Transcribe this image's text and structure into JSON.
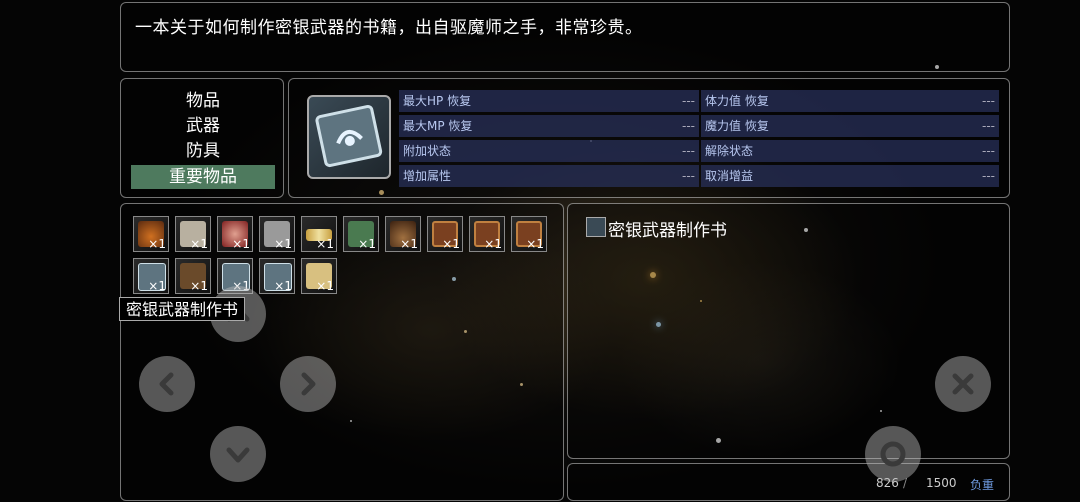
{
  "description": "一本关于如何制作密银武器的书籍，出自驱魔师之手，非常珍贵。",
  "categories": [
    "物品",
    "武器",
    "防具",
    "重要物品"
  ],
  "selected_category": "重要物品",
  "stats": {
    "max_hp": {
      "label": "最大HP 恢复",
      "value": "---"
    },
    "max_mp": {
      "label": "最大MP 恢复",
      "value": "---"
    },
    "add_state": {
      "label": "附加状态",
      "value": "---"
    },
    "add_attr": {
      "label": "增加属性",
      "value": "---"
    },
    "stamina": {
      "label": "体力值 恢复",
      "value": "---"
    },
    "mana": {
      "label": "魔力值 恢复",
      "value": "---"
    },
    "remove_state": {
      "label": "解除状态",
      "value": "---"
    },
    "remove_buff": {
      "label": "取消增益",
      "value": "---"
    }
  },
  "inventory": [
    {
      "icon": "potion-icon",
      "qty": "×1"
    },
    {
      "icon": "map-icon",
      "qty": "×1"
    },
    {
      "icon": "ham-icon",
      "qty": "×1"
    },
    {
      "icon": "stone-tablet-icon",
      "qty": "×1"
    },
    {
      "icon": "scroll-icon",
      "qty": "×1"
    },
    {
      "icon": "green-book-icon",
      "qty": "×1"
    },
    {
      "icon": "pouch-icon",
      "qty": "×1"
    },
    {
      "icon": "chest-icon",
      "qty": "×1"
    },
    {
      "icon": "chest-icon",
      "qty": "×1"
    },
    {
      "icon": "chest-icon",
      "qty": "×1"
    },
    {
      "icon": "silver-book-icon",
      "qty": "×1"
    },
    {
      "icon": "wooden-box-icon",
      "qty": "×1"
    },
    {
      "icon": "silver-book-icon",
      "qty": "×1"
    },
    {
      "icon": "silver-book-icon",
      "qty": "×1"
    },
    {
      "icon": "parchment-icon",
      "qty": "×1"
    }
  ],
  "tooltip": "密银武器制作书",
  "detail_title": "密银武器制作书",
  "weight": {
    "current": "826",
    "max": "1500",
    "label": "负重"
  },
  "colors": {
    "selected_category": "#4e7a5e",
    "stat_row": "#28305a",
    "weight_label": "#6f9be0"
  }
}
